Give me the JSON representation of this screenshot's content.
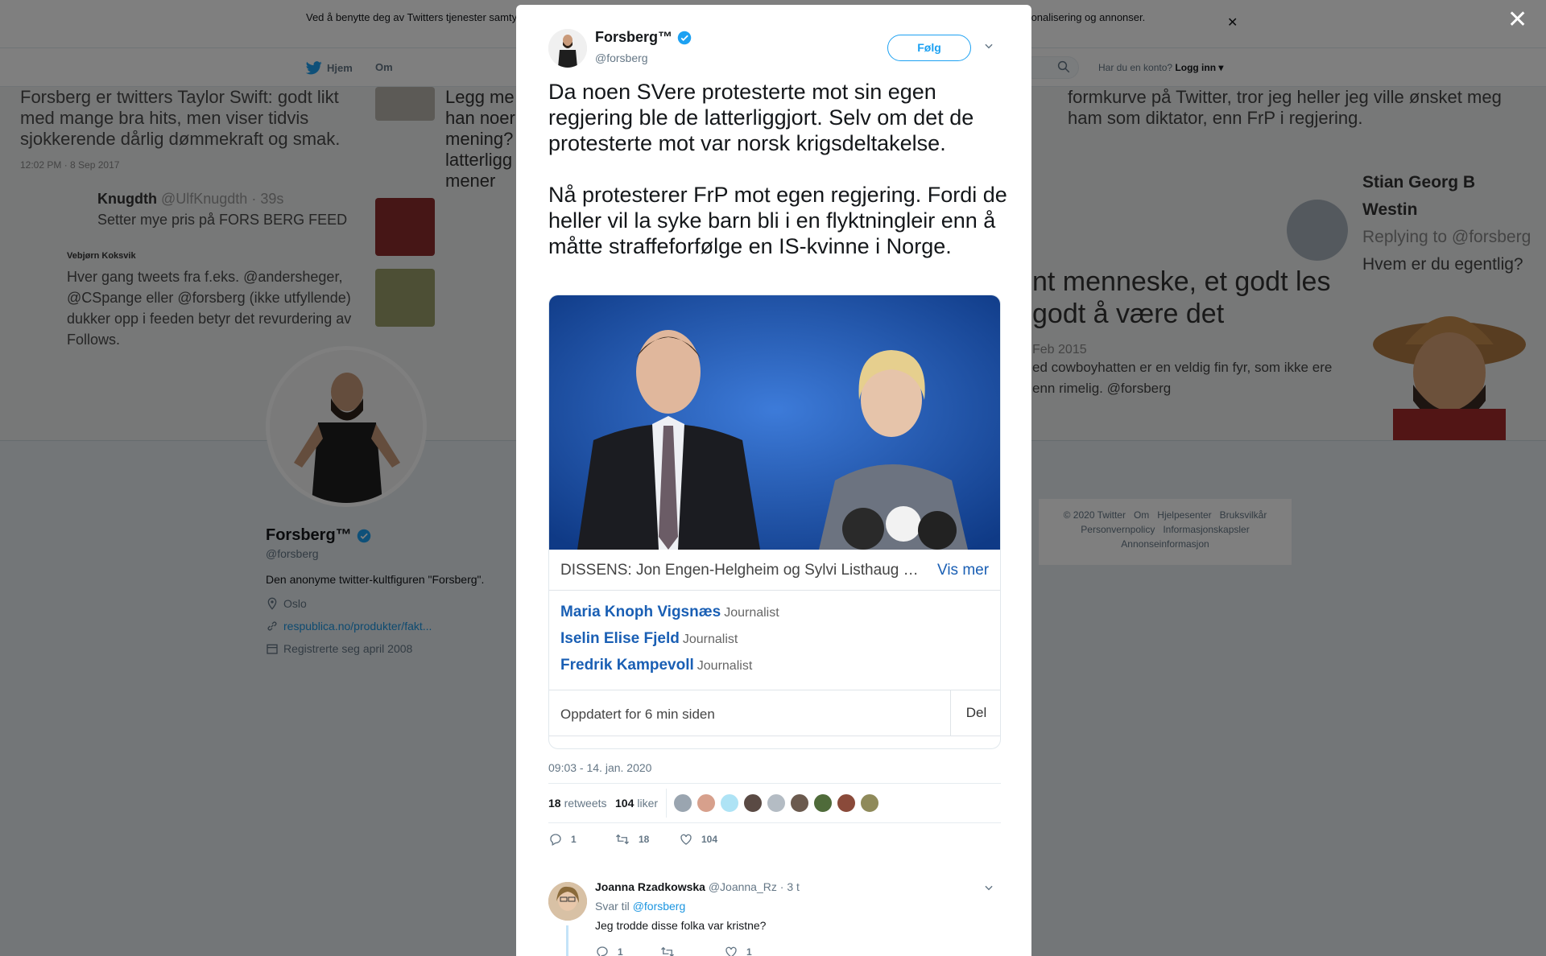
{
  "cookie_bar": {
    "text": "Ved å benytte deg av Twitters tjenester samtykker du i vår bruk av informasjonskapsler. Vi og våre partnere bruker informasjonskapsler til bl.a. analyser, personalisering og annonser."
  },
  "topnav": {
    "home_label": "Hjem",
    "about_label": "Om",
    "account_prompt": "Har du en konto?",
    "login_label": "Logg inn"
  },
  "banner": {
    "left_text": "Forsberg er twitters Taylor Swift: godt likt med mange bra hits, men viser tidvis sjokkerende dårlig dømmekraft og smak.",
    "left_time": "12:02 PM · 8 Sep 2017",
    "rt1_name": "Knugdth",
    "rt1_handle": "@UlfKnugdth · 39s",
    "rt1_text": "Setter mye pris på FORS BERG FEED",
    "rt2_name": "Vebjørn Koksvik",
    "rt2_text": "Hver gang tweets fra f.eks. @andersheger, @CSpange eller @forsberg (ikke utfyllende) dukker opp i feeden betyr det revurdering av Follows.",
    "mid_text": "Legg me han noer mening? latterligg mener",
    "right_text": "formkurve på Twitter, tror jeg heller jeg ville ønsket meg ham som diktator, enn FrP i regjering.",
    "right_name": "Stian Georg B Westin",
    "right_reply": "Replying to @forsberg",
    "right_question": "Hvem er du egentlig?",
    "right_big": "nt menneske, et godt les godt å være det",
    "right_date": "Feb 2015",
    "right_cowboy": "ed cowboyhatten er en veldig fin fyr, som ikke ere enn rimelig. @forsberg"
  },
  "profile": {
    "name": "Forsberg™",
    "handle": "@forsberg",
    "bio": "Den anonyme twitter-kultfiguren \"Forsberg\".",
    "location": "Oslo",
    "link": "respublica.no/produkter/fakt...",
    "joined": "Registrerte seg april 2008"
  },
  "footer": {
    "items": [
      "© 2020 Twitter",
      "Om",
      "Hjelpesenter",
      "Bruksvilkår",
      "Personvernpolicy",
      "Informasjonskapsler",
      "Annonseinformasjon"
    ]
  },
  "tweet": {
    "author_name": "Forsberg™",
    "author_handle": "@forsberg",
    "follow_label": "Følg",
    "text": "Da noen SVere protesterte mot sin egen regjering ble de latterliggjort. Selv om det de protesterte mot var norsk krigsdeltakelse.\n\nNå protesterer FrP mot egen regjering. Fordi de heller vil la syke barn bli i en flyktningleir enn å måtte straffeforfølge en IS-kvinne i Norge.",
    "card": {
      "title": "DISSENS: Jon Engen-Helgheim og Sylvi Listhaug vil ikke ha IS-kvinnen hjem",
      "more_label": "Vis mer",
      "journalists": [
        {
          "name": "Maria Knoph Vigsnæs",
          "role": "Journalist"
        },
        {
          "name": "Iselin Elise Fjeld",
          "role": "Journalist"
        },
        {
          "name": "Fredrik Kampevoll",
          "role": "Journalist"
        }
      ],
      "updated": "Oppdatert for 6 min siden",
      "share_label": "Del"
    },
    "timestamp": "09:03 - 14. jan. 2020",
    "retweets_count": "18",
    "retweets_label": "retweets",
    "likes_count": "104",
    "likes_label": "liker",
    "action_reply_count": "1",
    "action_retweet_count": "18",
    "action_like_count": "104"
  },
  "reply": {
    "name": "Joanna Rzadkowska",
    "handle": "@Joanna_Rz",
    "time": "· 3 t",
    "reply_to_label": "Svar til",
    "reply_to_handle": "@forsberg",
    "text": "Jeg trodde disse folka var kristne?",
    "reply_count": "1",
    "like_count": "1"
  },
  "colors": {
    "accent": "#1da1f2",
    "link": "#1b95e0",
    "card_link": "#1a5fb4",
    "verified": "#1da1f2",
    "overlay": "rgba(0,0,0,0.5)"
  },
  "icons": [
    "twitter-bird-icon",
    "search-icon",
    "close-icon",
    "verified-badge-icon",
    "chevron-down-icon",
    "location-icon",
    "link-icon",
    "calendar-icon",
    "reply-icon",
    "retweet-icon",
    "heart-icon"
  ]
}
